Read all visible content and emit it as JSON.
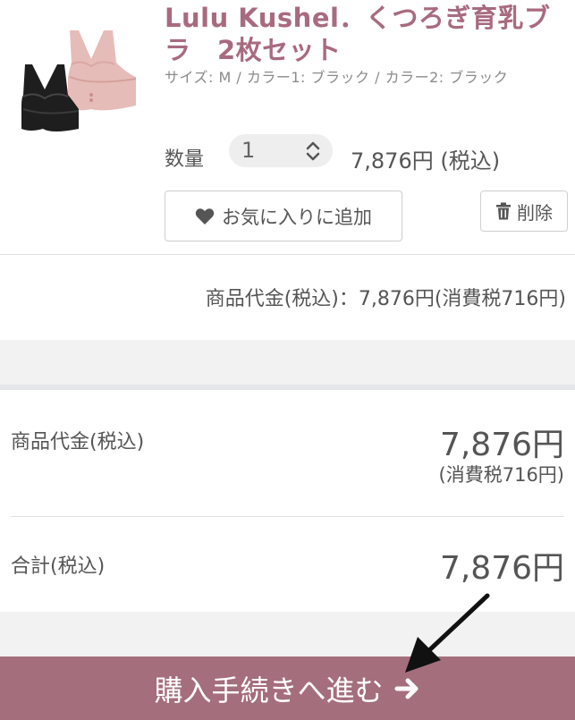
{
  "product": {
    "title": "Lulu Kushel．くつろぎ育乳ブラ　2枚セット",
    "variant": "サイズ: M / カラー1: ブラック / カラー2: ブラック",
    "qty_label": "数量",
    "qty_value": "1",
    "price": "7,876円 (税込)",
    "favorite_label": "お気に入りに追加",
    "delete_label": "削除",
    "image_alt_icon": "bra-product-thumbnail"
  },
  "subtotal_line": "商品代金(税込)：7,876円(消費税716円)",
  "summary": {
    "subtotal_label": "商品代金(税込)",
    "subtotal_value": "7,876円",
    "tax_note": "(消費税716円)",
    "total_label": "合計(税込)",
    "total_value": "7,876円"
  },
  "checkout": {
    "label": "購入手続きへ進む",
    "icon": "arrow-right-icon"
  },
  "colors": {
    "accent": "#a56e7d",
    "title": "#a86a80"
  }
}
